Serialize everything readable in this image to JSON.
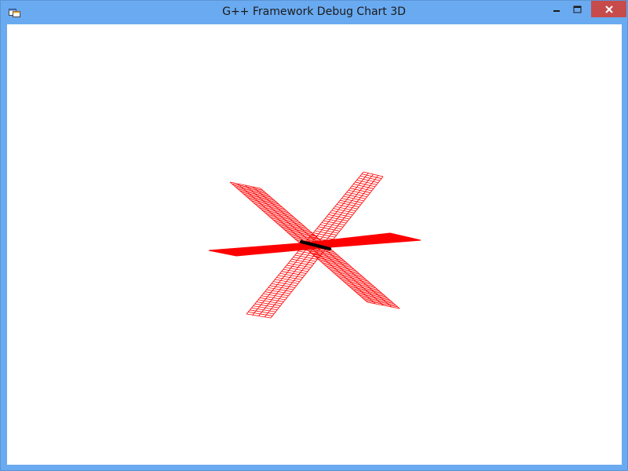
{
  "window": {
    "title": "G++ Framework Debug Chart 3D",
    "accent_color": "#6aaaf0",
    "close_color": "#c74b4b",
    "app_icon": "app-window-icon",
    "controls": {
      "minimize_icon": "minimize-icon",
      "maximize_icon": "maximize-icon",
      "close_icon": "close-icon"
    }
  },
  "chart_data": {
    "type": "surface-3d",
    "series_color": "#ff0000",
    "axis_color": "#000000"
  }
}
